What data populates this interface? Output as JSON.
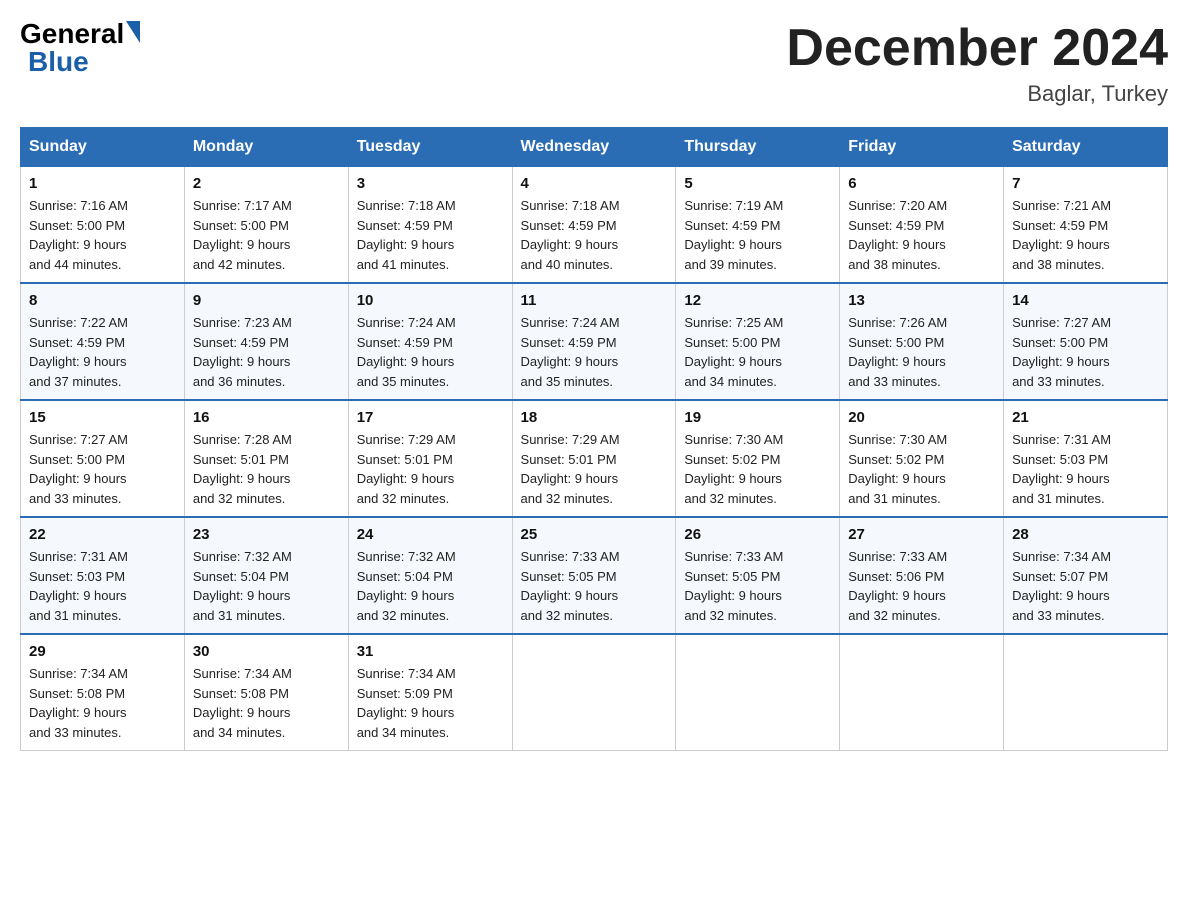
{
  "logo": {
    "general": "General",
    "blue": "Blue"
  },
  "title": "December 2024",
  "subtitle": "Baglar, Turkey",
  "days_of_week": [
    "Sunday",
    "Monday",
    "Tuesday",
    "Wednesday",
    "Thursday",
    "Friday",
    "Saturday"
  ],
  "weeks": [
    [
      {
        "day": "1",
        "sunrise": "7:16 AM",
        "sunset": "5:00 PM",
        "daylight": "9 hours and 44 minutes."
      },
      {
        "day": "2",
        "sunrise": "7:17 AM",
        "sunset": "5:00 PM",
        "daylight": "9 hours and 42 minutes."
      },
      {
        "day": "3",
        "sunrise": "7:18 AM",
        "sunset": "4:59 PM",
        "daylight": "9 hours and 41 minutes."
      },
      {
        "day": "4",
        "sunrise": "7:18 AM",
        "sunset": "4:59 PM",
        "daylight": "9 hours and 40 minutes."
      },
      {
        "day": "5",
        "sunrise": "7:19 AM",
        "sunset": "4:59 PM",
        "daylight": "9 hours and 39 minutes."
      },
      {
        "day": "6",
        "sunrise": "7:20 AM",
        "sunset": "4:59 PM",
        "daylight": "9 hours and 38 minutes."
      },
      {
        "day": "7",
        "sunrise": "7:21 AM",
        "sunset": "4:59 PM",
        "daylight": "9 hours and 38 minutes."
      }
    ],
    [
      {
        "day": "8",
        "sunrise": "7:22 AM",
        "sunset": "4:59 PM",
        "daylight": "9 hours and 37 minutes."
      },
      {
        "day": "9",
        "sunrise": "7:23 AM",
        "sunset": "4:59 PM",
        "daylight": "9 hours and 36 minutes."
      },
      {
        "day": "10",
        "sunrise": "7:24 AM",
        "sunset": "4:59 PM",
        "daylight": "9 hours and 35 minutes."
      },
      {
        "day": "11",
        "sunrise": "7:24 AM",
        "sunset": "4:59 PM",
        "daylight": "9 hours and 35 minutes."
      },
      {
        "day": "12",
        "sunrise": "7:25 AM",
        "sunset": "5:00 PM",
        "daylight": "9 hours and 34 minutes."
      },
      {
        "day": "13",
        "sunrise": "7:26 AM",
        "sunset": "5:00 PM",
        "daylight": "9 hours and 33 minutes."
      },
      {
        "day": "14",
        "sunrise": "7:27 AM",
        "sunset": "5:00 PM",
        "daylight": "9 hours and 33 minutes."
      }
    ],
    [
      {
        "day": "15",
        "sunrise": "7:27 AM",
        "sunset": "5:00 PM",
        "daylight": "9 hours and 33 minutes."
      },
      {
        "day": "16",
        "sunrise": "7:28 AM",
        "sunset": "5:01 PM",
        "daylight": "9 hours and 32 minutes."
      },
      {
        "day": "17",
        "sunrise": "7:29 AM",
        "sunset": "5:01 PM",
        "daylight": "9 hours and 32 minutes."
      },
      {
        "day": "18",
        "sunrise": "7:29 AM",
        "sunset": "5:01 PM",
        "daylight": "9 hours and 32 minutes."
      },
      {
        "day": "19",
        "sunrise": "7:30 AM",
        "sunset": "5:02 PM",
        "daylight": "9 hours and 32 minutes."
      },
      {
        "day": "20",
        "sunrise": "7:30 AM",
        "sunset": "5:02 PM",
        "daylight": "9 hours and 31 minutes."
      },
      {
        "day": "21",
        "sunrise": "7:31 AM",
        "sunset": "5:03 PM",
        "daylight": "9 hours and 31 minutes."
      }
    ],
    [
      {
        "day": "22",
        "sunrise": "7:31 AM",
        "sunset": "5:03 PM",
        "daylight": "9 hours and 31 minutes."
      },
      {
        "day": "23",
        "sunrise": "7:32 AM",
        "sunset": "5:04 PM",
        "daylight": "9 hours and 31 minutes."
      },
      {
        "day": "24",
        "sunrise": "7:32 AM",
        "sunset": "5:04 PM",
        "daylight": "9 hours and 32 minutes."
      },
      {
        "day": "25",
        "sunrise": "7:33 AM",
        "sunset": "5:05 PM",
        "daylight": "9 hours and 32 minutes."
      },
      {
        "day": "26",
        "sunrise": "7:33 AM",
        "sunset": "5:05 PM",
        "daylight": "9 hours and 32 minutes."
      },
      {
        "day": "27",
        "sunrise": "7:33 AM",
        "sunset": "5:06 PM",
        "daylight": "9 hours and 32 minutes."
      },
      {
        "day": "28",
        "sunrise": "7:34 AM",
        "sunset": "5:07 PM",
        "daylight": "9 hours and 33 minutes."
      }
    ],
    [
      {
        "day": "29",
        "sunrise": "7:34 AM",
        "sunset": "5:08 PM",
        "daylight": "9 hours and 33 minutes."
      },
      {
        "day": "30",
        "sunrise": "7:34 AM",
        "sunset": "5:08 PM",
        "daylight": "9 hours and 34 minutes."
      },
      {
        "day": "31",
        "sunrise": "7:34 AM",
        "sunset": "5:09 PM",
        "daylight": "9 hours and 34 minutes."
      },
      null,
      null,
      null,
      null
    ]
  ],
  "labels": {
    "sunrise": "Sunrise:",
    "sunset": "Sunset:",
    "daylight": "Daylight:"
  }
}
